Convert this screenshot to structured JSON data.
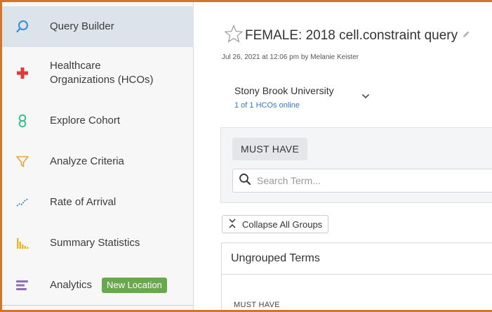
{
  "sidebar": {
    "items": [
      {
        "label": "Query Builder",
        "icon": "search-icon",
        "active": true
      },
      {
        "label": "Healthcare\nOrganizations (HCOs)",
        "icon": "plus-icon"
      },
      {
        "label": "Explore Cohort",
        "icon": "cohort-icon"
      },
      {
        "label": "Analyze Criteria",
        "icon": "funnel-icon"
      },
      {
        "label": "Rate of Arrival",
        "icon": "trend-line-icon"
      },
      {
        "label": "Summary Statistics",
        "icon": "bar-chart-icon"
      },
      {
        "label": "Analytics",
        "icon": "analytics-icon",
        "badge": "New Location"
      }
    ]
  },
  "main": {
    "title": "FEMALE: 2018 cell.constraint query",
    "meta": "Jul 26, 2021 at 12:06 pm by Melanie Keister",
    "org": {
      "name": "Stony Brook University",
      "status": "1 of 1 HCOs online"
    },
    "must_have_label": "MUST HAVE",
    "search_placeholder": "Search Term...",
    "collapse_label": "Collapse All Groups",
    "ungrouped_label": "Ungrouped Terms",
    "ungrouped_must_have": "MUST HAVE"
  },
  "colors": {
    "accent_border": "#d4762a",
    "link_blue": "#2f7bbf",
    "badge_green": "#6aa84f",
    "active_bg": "#dde3ea"
  }
}
